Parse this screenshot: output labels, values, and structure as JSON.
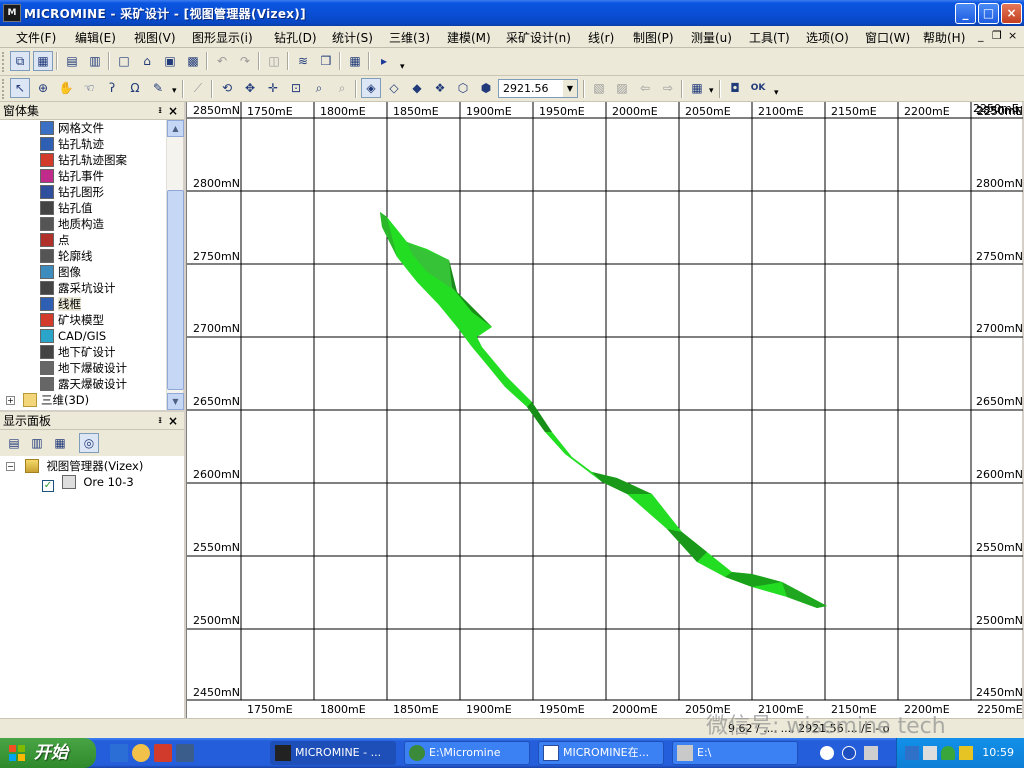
{
  "window": {
    "title": "MICROMINE - 采矿设计 - [视图管理器(Vizex)]",
    "controls": {
      "minimize": "_",
      "maximize": "□",
      "close": "×"
    }
  },
  "menubar": {
    "items": [
      "文件(F)",
      "编辑(E)",
      "视图(V)",
      "图形显示(i)",
      "钻孔(D)",
      "统计(S)",
      "三维(3)",
      "建模(M)",
      "采矿设计(n)",
      "线(r)",
      "制图(P)",
      "测量(u)",
      "工具(T)",
      "选项(O)",
      "窗口(W)",
      "帮助(H)"
    ],
    "mdi_controls": {
      "minimize": "_",
      "restore": "❐",
      "close": "×"
    }
  },
  "toolbar2": {
    "zoom_value": "2921.56"
  },
  "panes": {
    "forms": {
      "title": "窗体集",
      "items": [
        {
          "label": "网格文件",
          "icon": "grid-file-icon",
          "color": "#3a6fc4"
        },
        {
          "label": "钻孔轨迹",
          "icon": "drillhole-trace-icon",
          "color": "#2f5fb3"
        },
        {
          "label": "钻孔轨迹图案",
          "icon": "drillhole-pattern-icon",
          "color": "#d23b2b"
        },
        {
          "label": "钻孔事件",
          "icon": "drillhole-event-icon",
          "color": "#c02a8a"
        },
        {
          "label": "钻孔图形",
          "icon": "drillhole-graph-icon",
          "color": "#2d4f9e"
        },
        {
          "label": "钻孔值",
          "icon": "drillhole-value-icon",
          "color": "#444444"
        },
        {
          "label": "地质构造",
          "icon": "structure-icon",
          "color": "#555555"
        },
        {
          "label": "点",
          "icon": "point-icon",
          "color": "#b0302a"
        },
        {
          "label": "轮廓线",
          "icon": "contour-icon",
          "color": "#555555"
        },
        {
          "label": "图像",
          "icon": "image-icon",
          "color": "#3c8dbd"
        },
        {
          "label": "露采坑设计",
          "icon": "pit-design-icon",
          "color": "#444444"
        },
        {
          "label": "线框",
          "icon": "wireframe-icon",
          "color": "#2f5fb3"
        },
        {
          "label": "矿块模型",
          "icon": "block-model-icon",
          "color": "#d23b2b"
        },
        {
          "label": "CAD/GIS",
          "icon": "cad-gis-icon",
          "color": "#2aa5c9"
        },
        {
          "label": "地下矿设计",
          "icon": "underground-design-icon",
          "color": "#444444"
        },
        {
          "label": "地下爆破设计",
          "icon": "underground-blast-icon",
          "color": "#666666"
        },
        {
          "label": "露天爆破设计",
          "icon": "openpit-blast-icon",
          "color": "#666666"
        }
      ],
      "folder": {
        "label": "三维(3D)",
        "expander": "+"
      }
    },
    "display": {
      "title": "显示面板",
      "root": {
        "label": "视图管理器(Vizex)",
        "expander": "−"
      },
      "layer": {
        "label": "Ore 10-3",
        "checked": true
      }
    }
  },
  "map": {
    "x_ticks": [
      "1750mE",
      "1800mE",
      "1850mE",
      "1900mE",
      "1950mE",
      "2000mE",
      "2050mE",
      "2100mE",
      "2150mE",
      "2200mE",
      "2250mE"
    ],
    "y_ticks": [
      "2850mN",
      "2800mN",
      "2750mN",
      "2700mN",
      "2650mN",
      "2600mN",
      "2550mN",
      "2500mN",
      "2450mN"
    ],
    "top_right_label": "2250mE",
    "bottom_tick_labels": [
      "1750mE",
      "1800mE",
      "1850mE",
      "1900mE",
      "1950mE",
      "2000mE",
      "2050mE",
      "2100mE",
      "2150mE",
      "2200mE",
      "2250mE"
    ],
    "wireframe_color": "#22dd22",
    "wireframe_dark": "#157a15"
  },
  "statusbar": {
    "text": "9.62 / ..., ..., 2921.56 ... /E - o"
  },
  "watermark": "微信号: wisemine tech",
  "taskbar": {
    "start_label": "开始",
    "tasks": [
      {
        "label": "MICROMINE - ...",
        "active": true
      },
      {
        "label": "E:\\Micromine",
        "active": false
      },
      {
        "label": "MICROMINE在...",
        "active": false
      },
      {
        "label": "E:\\",
        "active": false
      }
    ],
    "clock": "10:59"
  }
}
